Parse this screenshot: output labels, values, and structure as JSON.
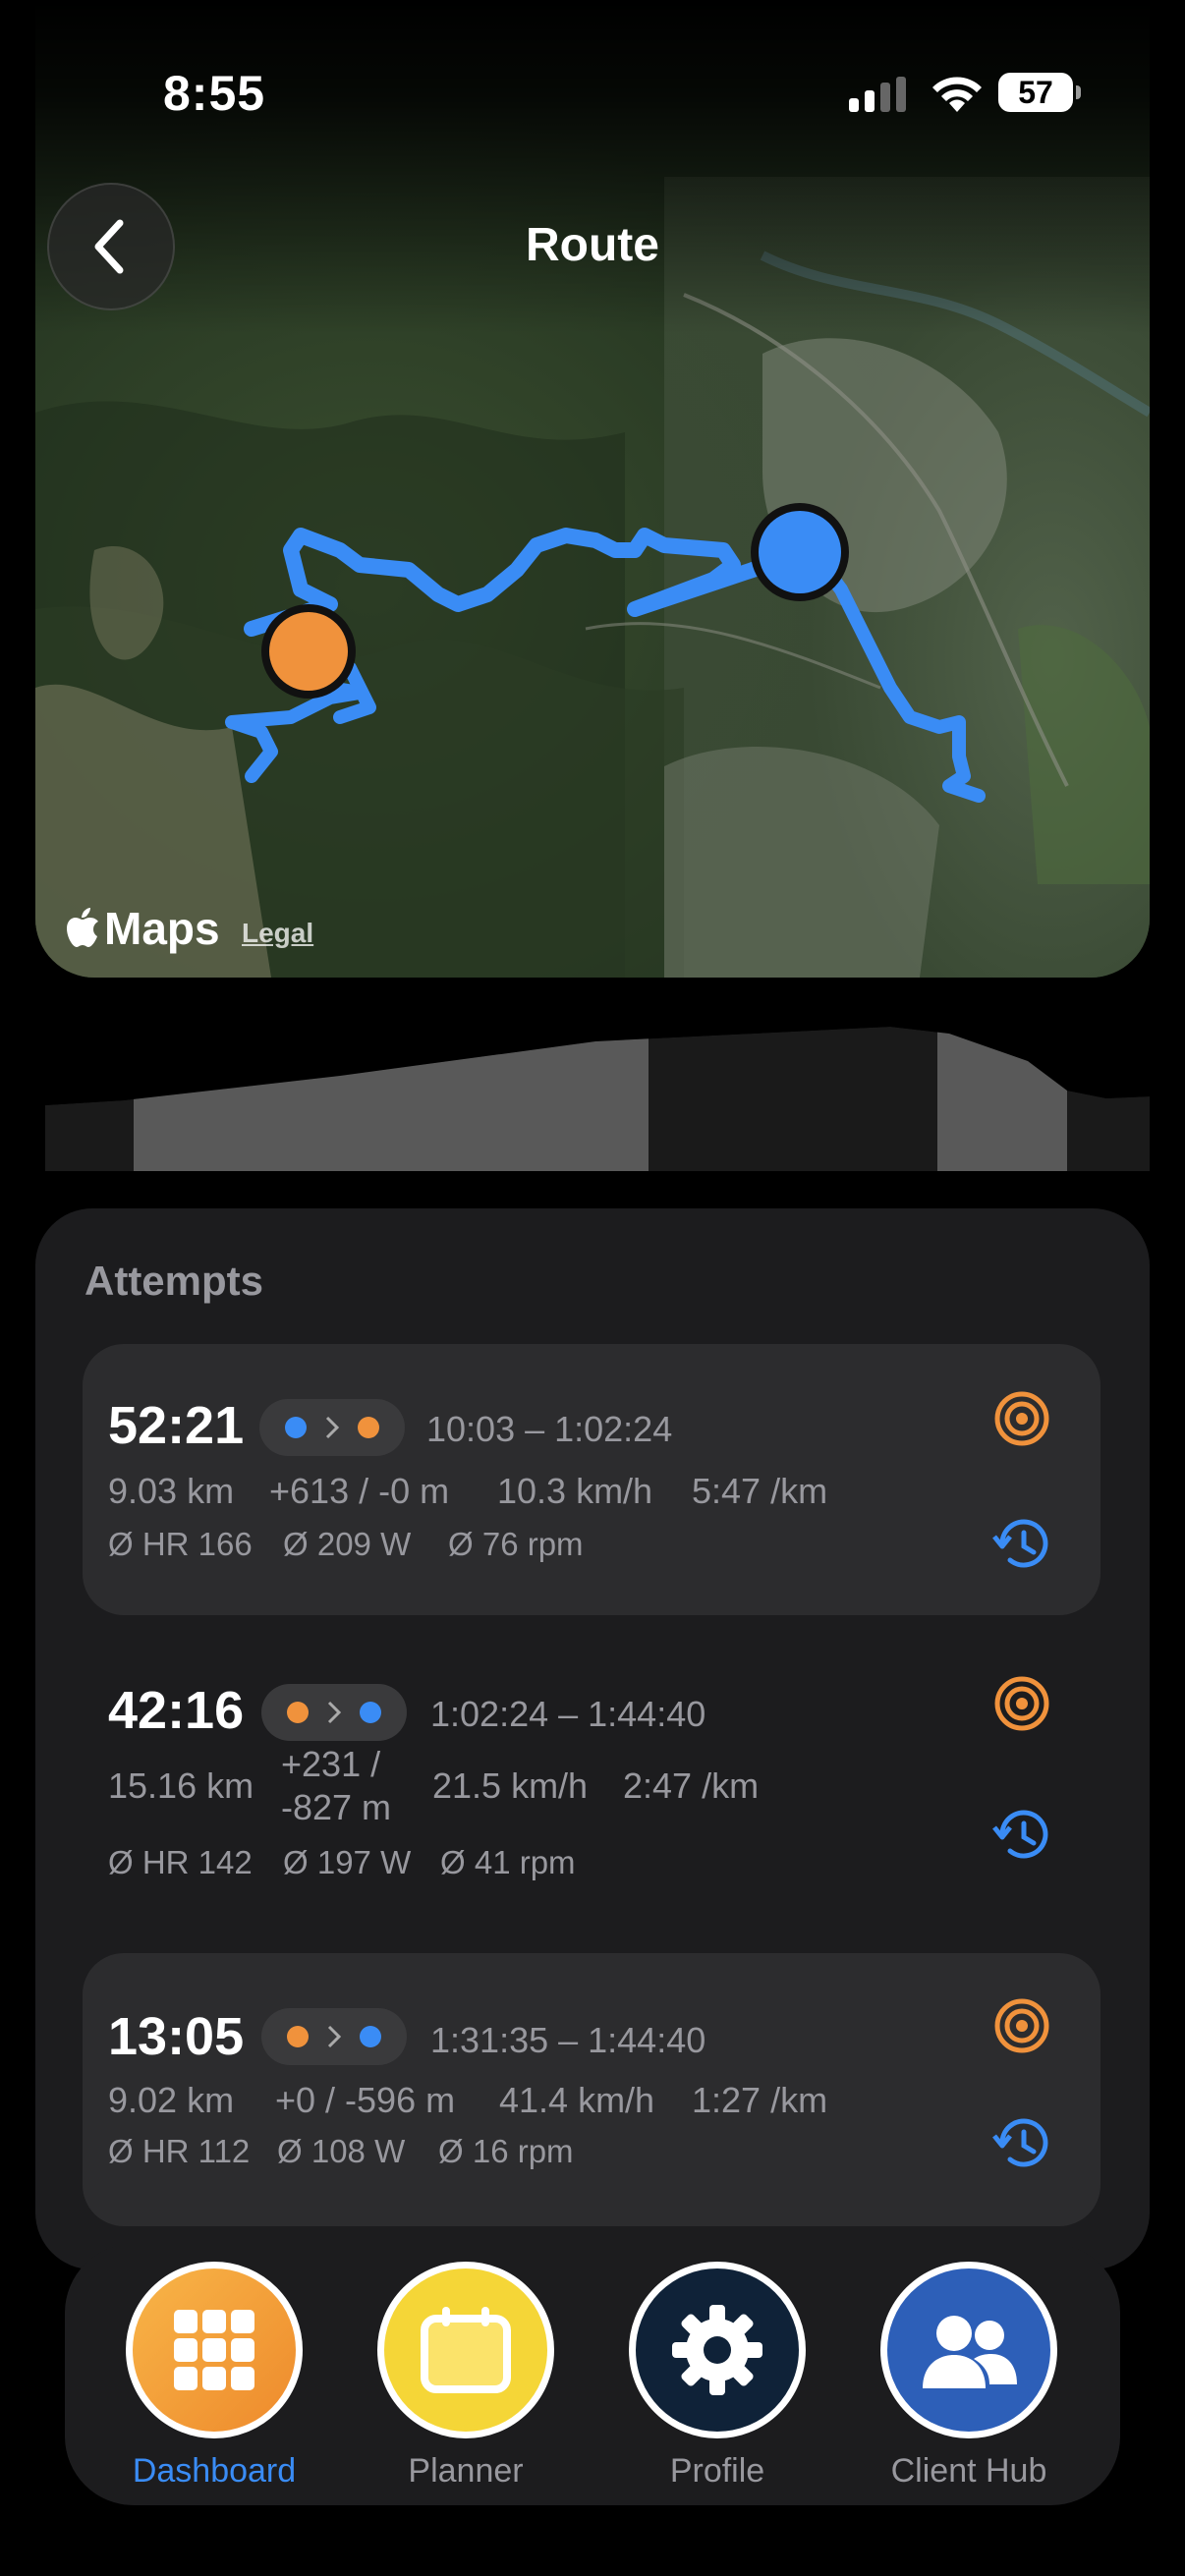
{
  "status_bar": {
    "time": "8:55",
    "battery": "57"
  },
  "header": {
    "title": "Route",
    "back_icon": "chevron-left-icon"
  },
  "map": {
    "provider": "Maps",
    "legal": "Legal",
    "route_color": "#3a8cf5",
    "start_color": "#3a8cf5",
    "end_color": "#f0923c"
  },
  "attempts": {
    "title": "Attempts",
    "items": [
      {
        "duration": "52:21",
        "from_color": "#3a8cf5",
        "to_color": "#f0923c",
        "time_range": "10:03 – 1:02:24",
        "distance": "9.03 km",
        "elevation": "+613 / -0 m",
        "speed": "10.3 km/h",
        "pace": "5:47 /km",
        "hr": "Ø HR 166",
        "power": "Ø 209 W",
        "cadence": "Ø 76 rpm",
        "highlighted": true
      },
      {
        "duration": "42:16",
        "from_color": "#f0923c",
        "to_color": "#3a8cf5",
        "time_range": "1:02:24 – 1:44:40",
        "distance": "15.16 km",
        "elevation_line1": "+231 /",
        "elevation_line2": "-827 m",
        "speed": "21.5 km/h",
        "pace": "2:47 /km",
        "hr": "Ø HR 142",
        "power": "Ø 197 W",
        "cadence": "Ø 41 rpm",
        "highlighted": false
      },
      {
        "duration": "13:05",
        "from_color": "#f0923c",
        "to_color": "#3a8cf5",
        "time_range": "1:31:35 – 1:44:40",
        "distance": "9.02 km",
        "elevation": "+0 / -596 m",
        "speed": "41.4 km/h",
        "pace": "1:27 /km",
        "hr": "Ø HR 112",
        "power": "Ø 108 W",
        "cadence": "Ø 16 rpm",
        "highlighted": true
      }
    ]
  },
  "tabbar": {
    "items": [
      {
        "label": "Dashboard",
        "icon": "grid-icon",
        "active": true
      },
      {
        "label": "Planner",
        "icon": "calendar-icon",
        "active": false
      },
      {
        "label": "Profile",
        "icon": "gear-icon",
        "active": false
      },
      {
        "label": "Client Hub",
        "icon": "people-icon",
        "active": false
      }
    ]
  }
}
